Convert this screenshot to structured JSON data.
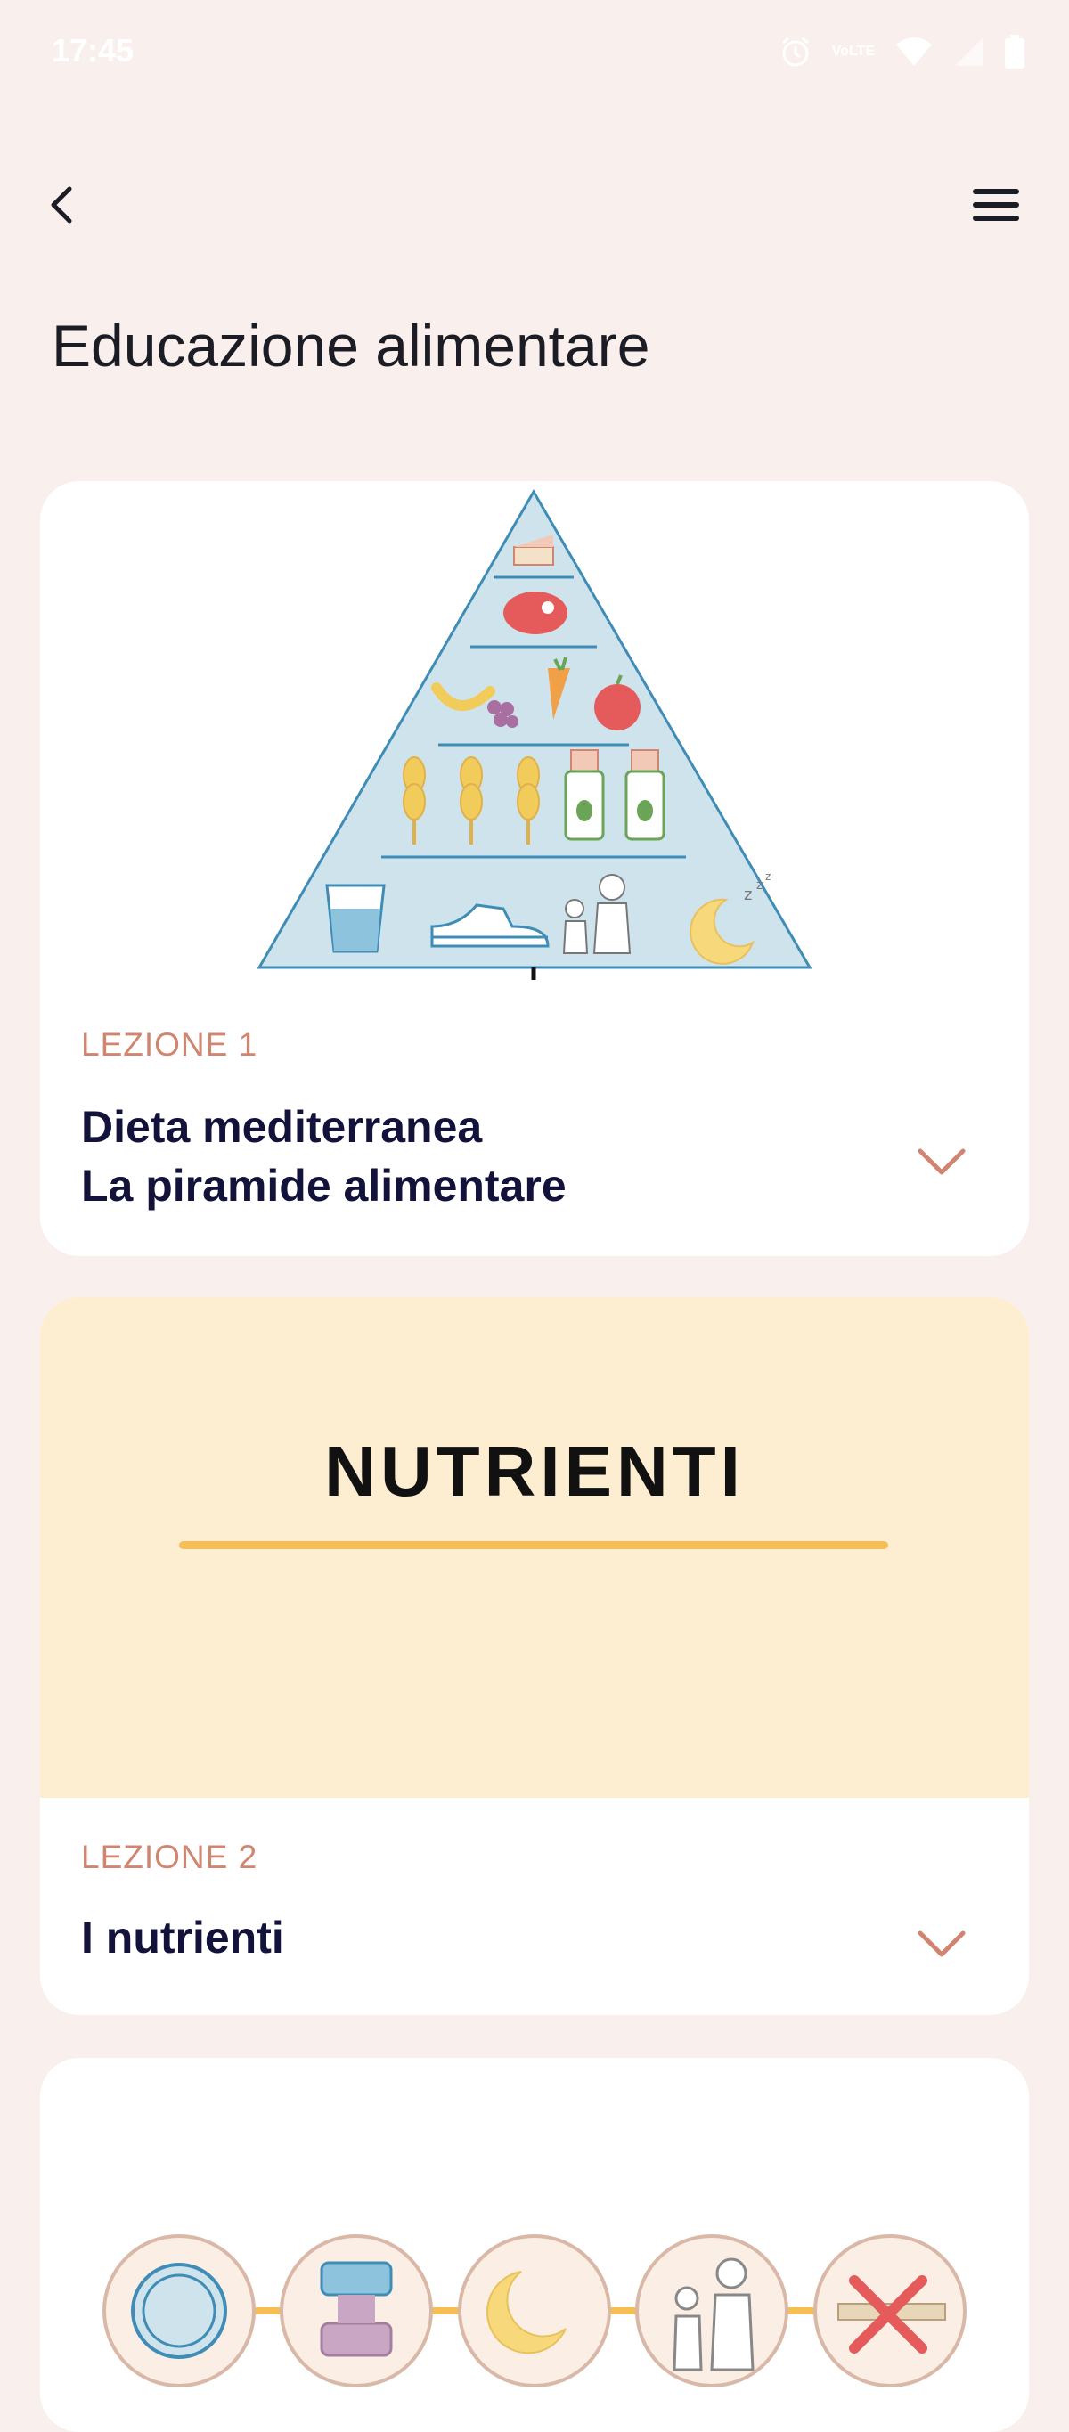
{
  "status_bar": {
    "time": "17:45",
    "network_label": "VoLTE",
    "icons": [
      "alarm-icon",
      "volte-icon",
      "wifi-icon",
      "signal-icon",
      "battery-icon"
    ]
  },
  "header": {
    "back_icon": "back-arrow-icon",
    "menu_icon": "hamburger-menu-icon",
    "title": "Educazione alimentare"
  },
  "lessons": [
    {
      "label": "LEZIONE 1",
      "title_line1": "Dieta mediterranea",
      "title_line2": "La piramide alimentare",
      "image": "food-pyramid",
      "expand_icon": "chevron-down-icon"
    },
    {
      "label": "LEZIONE 2",
      "title_line1": "I nutrienti",
      "banner_text": "NUTRIENTI",
      "expand_icon": "chevron-down-icon"
    },
    {
      "image_icons": [
        "plate-icon",
        "dumbbell-icon",
        "moon-sleep-icon",
        "family-icon",
        "no-smoking-icon"
      ]
    }
  ],
  "colors": {
    "background": "#f9efed",
    "card": "#ffffff",
    "lesson_label": "#d1846f",
    "lesson_title": "#12123a",
    "banner_bg": "#fdeed2",
    "banner_accent": "#f5bf55",
    "pyramid_fill": "#cfe3ec",
    "pyramid_stroke": "#3f8db6"
  }
}
